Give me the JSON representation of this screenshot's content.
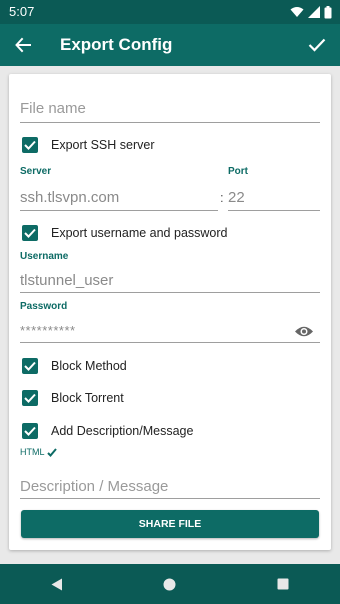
{
  "status": {
    "time": "5:07"
  },
  "app_bar": {
    "title": "Export Config",
    "back_icon": "arrow-left-icon",
    "confirm_icon": "check-icon"
  },
  "form": {
    "file_name_placeholder": "File name",
    "export_ssh_label": "Export SSH server",
    "export_ssh_checked": true,
    "server_label": "Server",
    "server_value": "ssh.tlsvpn.com",
    "port_separator": ":",
    "port_label": "Port",
    "port_value": "22",
    "export_credentials_label": "Export username and password",
    "export_credentials_checked": true,
    "username_label": "Username",
    "username_value": "tlstunnel_user",
    "password_label": "Password",
    "password_value": "**********",
    "block_method_label": "Block Method",
    "block_method_checked": true,
    "block_torrent_label": "Block Torrent",
    "block_torrent_checked": true,
    "add_description_label": "Add Description/Message",
    "add_description_checked": true,
    "html_label": "HTML",
    "description_placeholder": "Description / Message",
    "share_button": "SHARE FILE"
  },
  "colors": {
    "primary": "#0d6b65",
    "primary_dark": "#0b5a55",
    "background": "#e9e9e9"
  }
}
